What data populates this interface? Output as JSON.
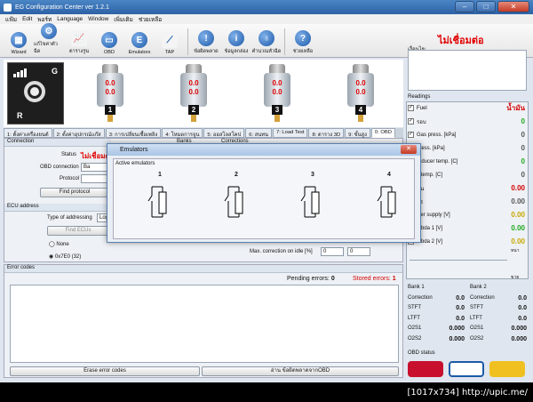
{
  "window": {
    "title": "EG Configuration Center ver 1.2.1"
  },
  "menu": [
    "แฟ้ม",
    "Edit",
    "พอร์ท",
    "Language",
    "Window",
    "เพิ่มเติม",
    "ช่วยเหลือ"
  ],
  "toolbar": [
    {
      "label": "Wizard",
      "icon": "grid-icon"
    },
    {
      "label": "แก้ไขค่าตัวฉีด",
      "icon": "gear-icon"
    },
    {
      "label": "ตารางรูน",
      "icon": "chart-icon"
    },
    {
      "label": "OBD",
      "icon": "obd-icon"
    },
    {
      "label": "Emulators",
      "icon": "e-icon"
    },
    {
      "label": "TAP",
      "icon": "tap-icon"
    },
    {
      "label": "ข้อผิดพลาด",
      "icon": "warning-icon"
    },
    {
      "label": "ข้อมูลกล่อง",
      "icon": "info-icon"
    },
    {
      "label": "คำนวณหัวฉีด",
      "icon": "injector-icon"
    },
    {
      "label": "ช่วยเหลือ",
      "icon": "help-icon"
    }
  ],
  "gauge_panel": {
    "g_label": "G",
    "r_label": "R"
  },
  "injectors": [
    {
      "num": "1",
      "v1": "0.0",
      "v2": "0.0"
    },
    {
      "num": "2",
      "v1": "0.0",
      "v2": "0.0"
    },
    {
      "num": "3",
      "v1": "0.0",
      "v2": "0.0"
    },
    {
      "num": "4",
      "v1": "0.0",
      "v2": "0.0"
    }
  ],
  "tabs": [
    "1: ตั้งค่าเครื่องยนต์",
    "2: ตั้งค่าอุปกรณ์แก๊ส",
    "3: การเปลี่ยนเชื้อเพลิง",
    "4: โหมดการจูน",
    "5: ออสโลสโคป",
    "6: สนทน",
    "7: Load Test",
    "8: ตาราง 3D",
    "9: ขั้นสูง",
    "0: OBD"
  ],
  "connection": {
    "header": "Connection",
    "status_label": "Status",
    "status_value": "ไม่เชื่อมต่อ",
    "obd_label": "OBD connection",
    "obd_value": "Ba",
    "protocol_label": "Protocol",
    "find_protocol": "Find protocol"
  },
  "ecu": {
    "header": "ECU address",
    "type_label": "Type of addressing",
    "type_value": "Log",
    "find_ecus": "Find ECUs",
    "opt_none": "None",
    "opt_addr": "0x7E0 (32)"
  },
  "banks_partial": "Banks",
  "corrections_partial": "Corrections",
  "max_correction": {
    "label": "Max. correction on idle [%]",
    "v1": "0",
    "v2": "0"
  },
  "errors": {
    "header": "Error codes",
    "pending_label": "Pending errors:",
    "pending_value": "0",
    "stored_label": "Stored errors:",
    "stored_value": "1",
    "erase_btn": "Erase error codes",
    "read_btn": "อ่าน ข้อผิดพลาดจากOBD"
  },
  "right_panel": {
    "notice_header": "เงื่อนไข",
    "status_red": "ไม่เชื่อมต่อ",
    "readings_header": "Readings",
    "fuel_label": "Fuel",
    "fuel_value": "น้ำมัน",
    "readings": [
      {
        "label": "รอบ",
        "value": "0",
        "color": "#1ea81e"
      },
      {
        "label": "Gas press. [kPa]",
        "value": "0",
        "color": "#555555"
      },
      {
        "label": "press. [kPa]",
        "value": "0",
        "color": "#555555"
      },
      {
        "label": "reducer temp. [C]",
        "value": "0",
        "color": "#1ea81e"
      },
      {
        "label": "s temp. [C]",
        "value": "0",
        "color": "#555555"
      },
      {
        "label": "ชั้น",
        "value": "0.00",
        "color": "#d40000"
      },
      {
        "label": "ตร",
        "value": "0.00",
        "color": "#555555"
      },
      {
        "label": "wer supply [V]",
        "value": "0.00",
        "color": "#c9a800"
      },
      {
        "label": "mbda 1 [V]",
        "value": "0.00",
        "color": "#1ea81e"
      },
      {
        "label": "mbda 2 [V]",
        "value": "0.00",
        "color": "#c9a800"
      }
    ],
    "small_top": "หนา",
    "small_bottom": "ขาย",
    "bank1": {
      "title": "Bank 1",
      "rows": [
        [
          "Correction",
          "0.0"
        ],
        [
          "STFT",
          "0.0"
        ],
        [
          "LTFT",
          "0.0"
        ],
        [
          "O2S1",
          "0.000"
        ],
        [
          "O2S2",
          "0.000"
        ]
      ]
    },
    "bank2": {
      "title": "Bank 2",
      "rows": [
        [
          "Correction",
          "0.0"
        ],
        [
          "STFT",
          "0.0"
        ],
        [
          "LTFT",
          "0.0"
        ],
        [
          "O2S1",
          "0.000"
        ],
        [
          "O2S2",
          "0.000"
        ]
      ]
    },
    "obd_status": "OBD status"
  },
  "dialog": {
    "title": "Emulators",
    "group": "Active emulators",
    "emulators": [
      "1",
      "2",
      "3",
      "4"
    ]
  },
  "watermark": "[1017x734] http://upic.me/"
}
